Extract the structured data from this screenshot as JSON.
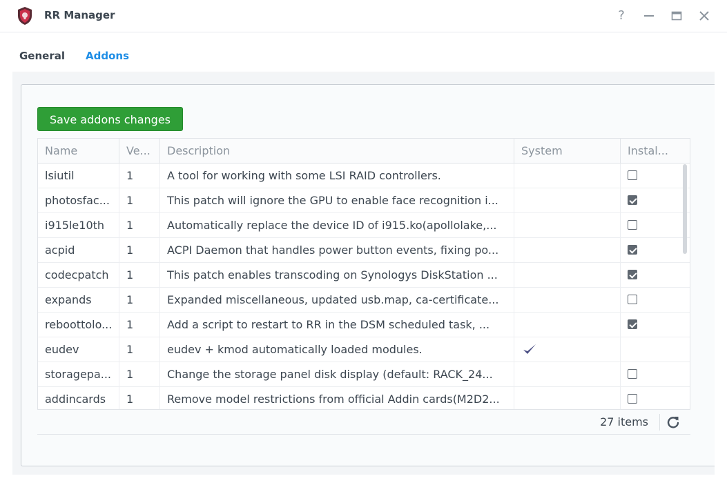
{
  "window": {
    "title": "RR Manager",
    "icon": "shield-icon"
  },
  "window_controls": {
    "help": "?",
    "minimize": "—",
    "maximize": "▭",
    "close": "✕"
  },
  "tabs": [
    {
      "label": "General",
      "active": false
    },
    {
      "label": "Addons",
      "active": true
    }
  ],
  "save_button": {
    "label": "Save addons changes"
  },
  "grid": {
    "columns": [
      "Name",
      "Ve...",
      "Description",
      "System",
      "Instal..."
    ],
    "rows": [
      {
        "name": "lsiutil",
        "version": "1",
        "description": "A tool for working with some LSI RAID controllers.",
        "system": false,
        "installed": false
      },
      {
        "name": "photosfac...",
        "version": "1",
        "description": "This patch will ignore the GPU to enable face recognition i...",
        "system": false,
        "installed": true
      },
      {
        "name": "i915le10th",
        "version": "1",
        "description": "Automatically replace the device ID of i915.ko(apollolake,...",
        "system": false,
        "installed": false
      },
      {
        "name": "acpid",
        "version": "1",
        "description": "ACPI Daemon that handles power button events, fixing po...",
        "system": false,
        "installed": true
      },
      {
        "name": "codecpatch",
        "version": "1",
        "description": "This patch enables transcoding on Synologys DiskStation ...",
        "system": false,
        "installed": true
      },
      {
        "name": "expands",
        "version": "1",
        "description": "Expanded miscellaneous, updated usb.map, ca-certificate...",
        "system": false,
        "installed": false
      },
      {
        "name": "reboottolo...",
        "version": "1",
        "description": "Add a script to restart to RR in the DSM scheduled task, ...",
        "system": false,
        "installed": true
      },
      {
        "name": "eudev",
        "version": "1",
        "description": "eudev + kmod automatically loaded modules.",
        "system": true,
        "installed": null
      },
      {
        "name": "storagepa...",
        "version": "1",
        "description": "Change the storage panel disk display (default: RACK_24...",
        "system": false,
        "installed": false
      },
      {
        "name": "addincards",
        "version": "1",
        "description": "Remove model restrictions from official Addin cards(M2D2...",
        "system": false,
        "installed": false
      }
    ]
  },
  "footer": {
    "items_count": "27 items"
  },
  "colors": {
    "accent": "#1f8ee6",
    "save_button": "#2f9e37",
    "system_check": "#4b4f84"
  }
}
